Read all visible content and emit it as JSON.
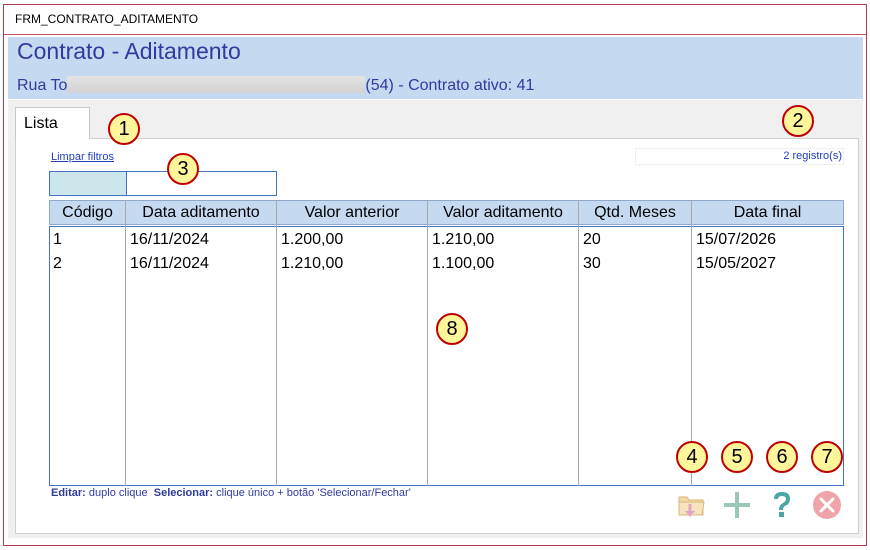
{
  "window": {
    "title": "FRM_CONTRATO_ADITAMENTO"
  },
  "form": {
    "title": "Contrato - Aditamento",
    "subtitle_start": "Rua To",
    "subtitle_end": "(54) - Contrato ativo: 41"
  },
  "tabs": [
    {
      "label": "Lista"
    }
  ],
  "filters": {
    "clear_label": "Limpar filtros",
    "value": "",
    "placeholder": ""
  },
  "record_count": "2 registro(s)",
  "grid": {
    "columns": [
      "Código",
      "Data aditamento",
      "Valor anterior",
      "Valor aditamento",
      "Qtd. Meses",
      "Data final"
    ],
    "rows": [
      [
        "1",
        "16/11/2024",
        "1.200,00",
        "1.210,00",
        "20",
        "15/07/2026"
      ],
      [
        "2",
        "16/11/2024",
        "1.210,00",
        "1.100,00",
        "30",
        "15/05/2027"
      ]
    ]
  },
  "footer": {
    "edit_label": "Editar:",
    "edit_text": "duplo clique",
    "select_label": "Selecionar:",
    "select_text": "clique único + botão 'Selecionar/Fechar'"
  },
  "buttons": [
    {
      "name": "select-close-button",
      "icon": "folder-down-icon"
    },
    {
      "name": "add-button",
      "icon": "plus-icon"
    },
    {
      "name": "help-button",
      "icon": "question-icon"
    },
    {
      "name": "close-button",
      "icon": "close-circle-icon"
    }
  ],
  "callouts": [
    "1",
    "2",
    "3",
    "4",
    "5",
    "6",
    "7",
    "8"
  ],
  "colors": {
    "header_band": "#c5d9f1",
    "title_text": "#2f3b9e",
    "link": "#1f3fbf",
    "callout_fill": "#fff59a",
    "callout_border": "#c00000",
    "frame_border": "#b43a4a"
  }
}
